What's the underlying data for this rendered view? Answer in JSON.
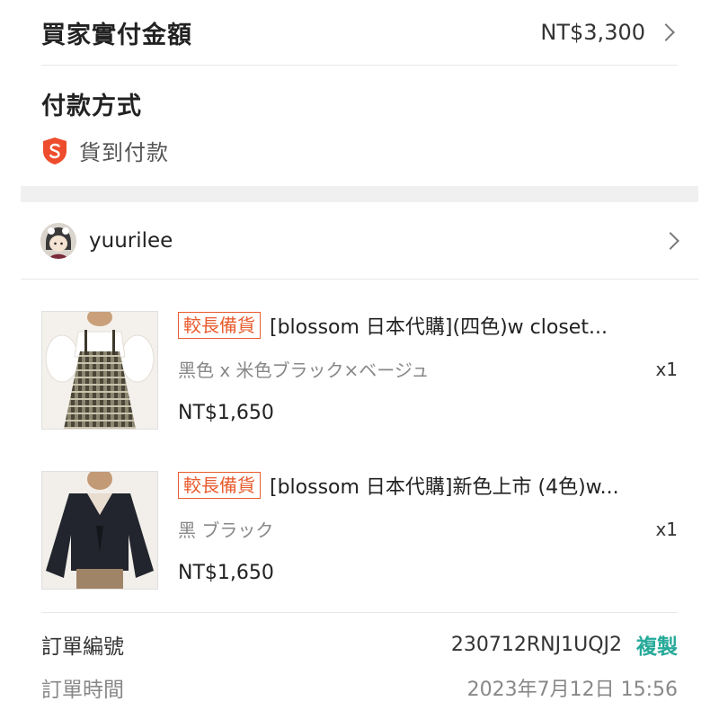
{
  "buyer_total": {
    "label": "買家實付金額",
    "amount": "NT$3,300"
  },
  "payment": {
    "title": "付款方式",
    "method": "貨到付款",
    "icon": "shopee-shield-icon"
  },
  "shop": {
    "name": "yuurilee"
  },
  "items": [
    {
      "tag": "較長備貨",
      "title": "[blossom 日本代購](四色)w closet...",
      "variant": "黑色 x 米色ブラック×ベージュ",
      "qty": "x1",
      "price": "NT$1,650"
    },
    {
      "tag": "較長備貨",
      "title": "[blossom 日本代購]新色上市 (4色)w...",
      "variant": "黑 ブラック",
      "qty": "x1",
      "price": "NT$1,650"
    }
  ],
  "order": {
    "number_label": "訂單編號",
    "number_value": "230712RNJ1UQJ2",
    "copy_label": "複製",
    "time_label": "訂單時間",
    "time_value": "2023年7月12日 15:56"
  },
  "colors": {
    "accent_orange": "#e85c2e",
    "copy_teal": "#26aa99"
  }
}
